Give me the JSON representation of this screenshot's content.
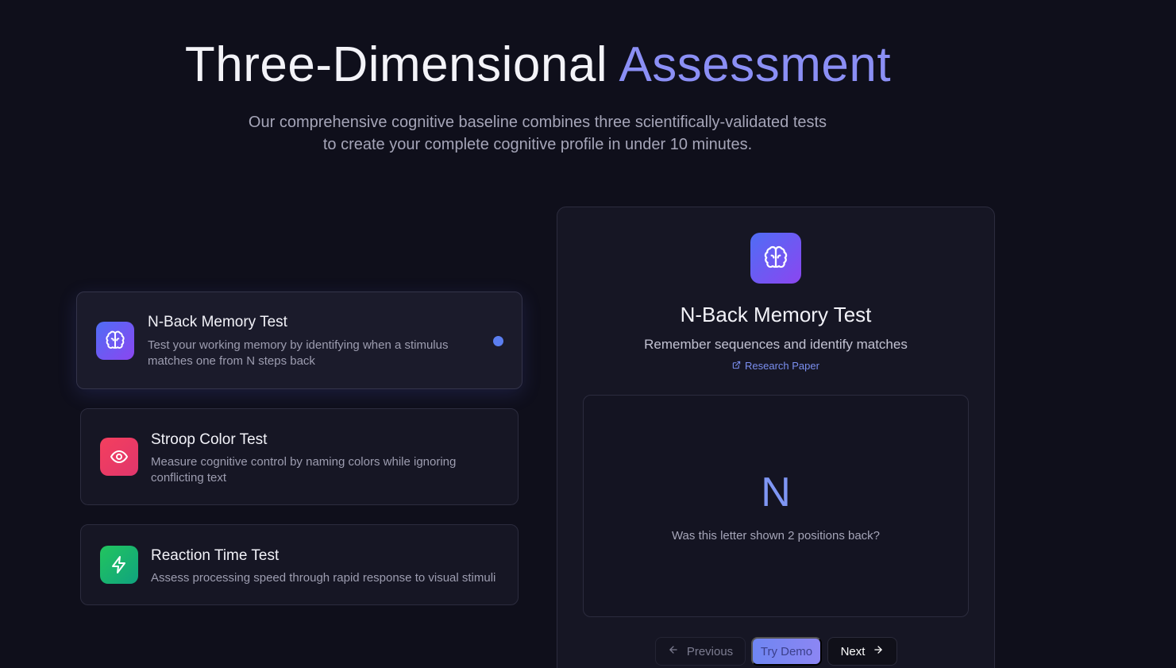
{
  "hero": {
    "title_main": "Three-Dimensional",
    "title_accent": "Assessment",
    "subtitle": "Our comprehensive cognitive baseline combines three scientifically-validated tests to create your complete cognitive profile in under 10 minutes."
  },
  "tests": [
    {
      "title": "N-Back Memory Test",
      "description": "Test your working memory by identifying when a stimulus matches one from N steps back",
      "icon": "brain-icon",
      "active": true
    },
    {
      "title": "Stroop Color Test",
      "description": "Measure cognitive control by naming colors while ignoring conflicting text",
      "icon": "eye-icon",
      "active": false
    },
    {
      "title": "Reaction Time Test",
      "description": "Assess processing speed through rapid response to visual stimuli",
      "icon": "bolt-icon",
      "active": false
    }
  ],
  "panel": {
    "icon": "brain-icon",
    "title": "N-Back Memory Test",
    "subtitle": "Remember sequences and identify matches",
    "link_label": "Research Paper",
    "demo": {
      "letter": "N",
      "question": "Was this letter shown 2 positions back?"
    },
    "buttons": {
      "previous": "Previous",
      "try_demo": "Try Demo",
      "next": "Next"
    }
  },
  "colors": {
    "background": "#0f0f1b",
    "accent": "#8b8ff5",
    "brain_gradient": [
      "#4f6df5",
      "#8b46f0"
    ],
    "eye_gradient": [
      "#f43f5e",
      "#e0366c"
    ],
    "bolt_gradient": [
      "#22c55e",
      "#10a37f"
    ]
  }
}
